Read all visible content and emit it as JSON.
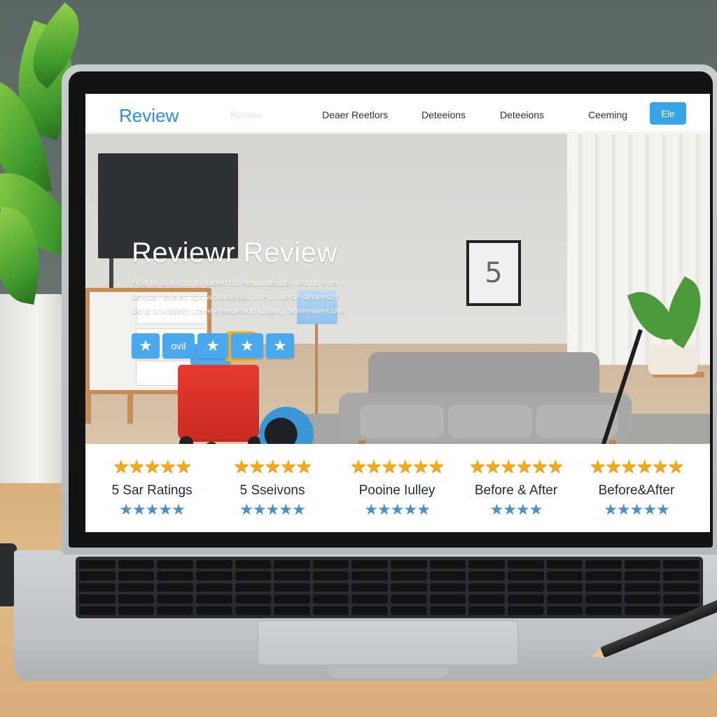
{
  "site": {
    "logo": "Review",
    "logo_faded": "Review",
    "nav": [
      "Deaer Reetlors",
      "Deteeions",
      "Deteeions",
      "Ceeming"
    ],
    "nav_button": "Ele"
  },
  "hero": {
    "title": "Reviewr Review",
    "text_lines": [
      "How to to wor to to tbleed nd eleuul deadee feo nd ewe",
      "dewbe nevelen toin wotereeeed tine tinute ae deneecer",
      "deng onwesetn ureee eleebes on ldtteng oeteeeweel uve."
    ],
    "star_buttons": [
      "★",
      "ovil",
      "★",
      "★",
      "★"
    ],
    "frame_number": "5"
  },
  "ratings": [
    {
      "label": "5 Sar Ratings",
      "gold": "★★★★★",
      "blue": "★★★★★"
    },
    {
      "label": "5 Sseivons",
      "gold": "★★★★★",
      "blue": "★★★★★"
    },
    {
      "label": "Pooine Iulley",
      "gold": "★★★★★★",
      "blue": "★★★★★"
    },
    {
      "label": "Before & After",
      "gold": "★★★★★★",
      "blue": "★★★★"
    },
    {
      "label": "Before&After",
      "gold": "★★★★★★",
      "blue": "★★★★★"
    }
  ],
  "colors": {
    "accent": "#39a4e8",
    "logo": "#2f8fd3",
    "gold_star": "#f4a917",
    "blue_star": "#4a8fc9"
  }
}
